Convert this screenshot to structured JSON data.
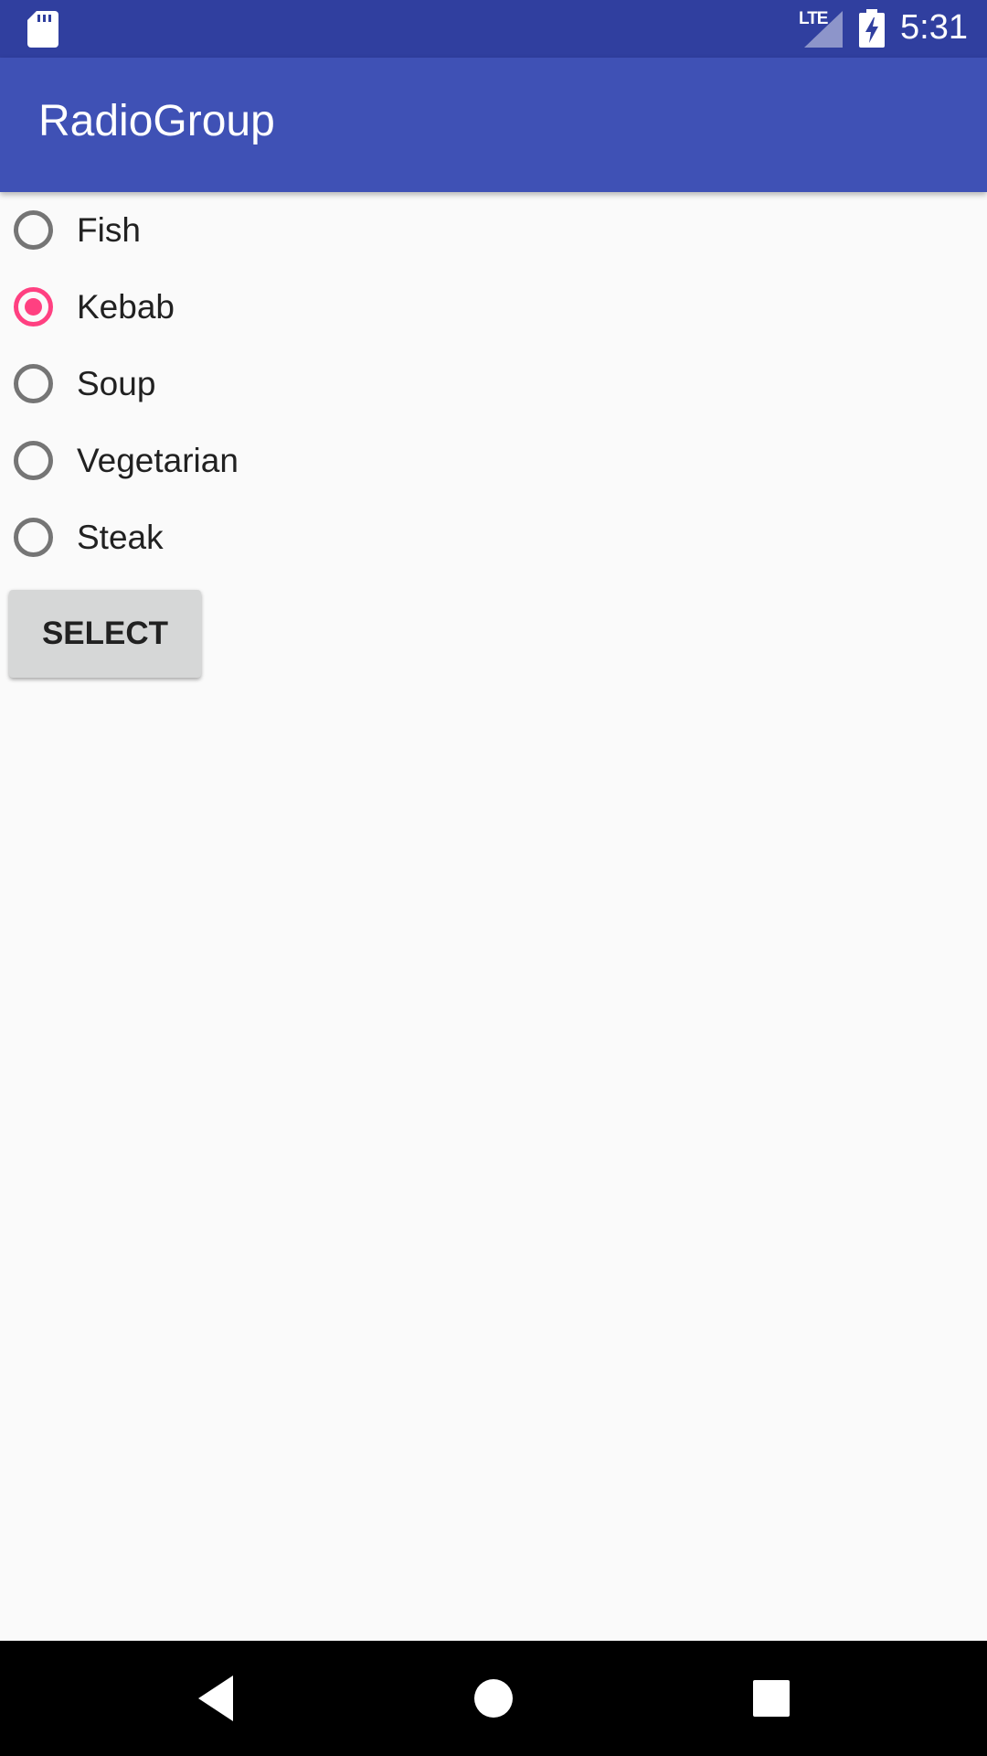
{
  "status_bar": {
    "network_label": "LTE",
    "time": "5:31",
    "icons": [
      "sd-card-icon",
      "signal-icon",
      "battery-charging-icon"
    ]
  },
  "app_bar": {
    "title": "RadioGroup"
  },
  "radio_group": {
    "options": [
      {
        "label": "Fish",
        "checked": false
      },
      {
        "label": "Kebab",
        "checked": true
      },
      {
        "label": "Soup",
        "checked": false
      },
      {
        "label": "Vegetarian",
        "checked": false
      },
      {
        "label": "Steak",
        "checked": false
      }
    ],
    "selected": "Kebab"
  },
  "select_button": {
    "label": "SELECT"
  },
  "nav_bar": {
    "buttons": [
      "back-icon",
      "home-icon",
      "recents-icon"
    ]
  },
  "colors": {
    "status_bar": "#303f9f",
    "app_bar": "#3f51b5",
    "accent": "#ff4081",
    "background": "#fafafa",
    "radio_unchecked": "#757575"
  }
}
